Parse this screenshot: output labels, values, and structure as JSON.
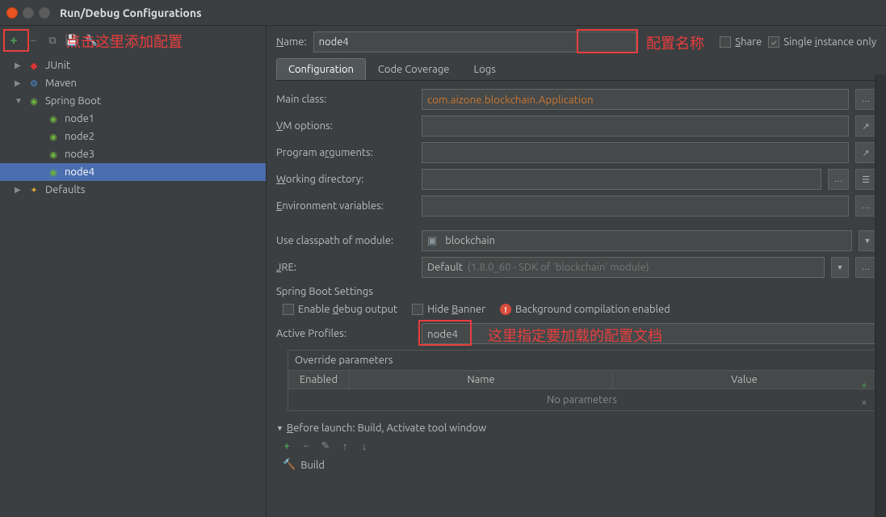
{
  "window": {
    "title": "Run/Debug Configurations"
  },
  "annotations": {
    "add_here": "点击这里添加配置",
    "config_name": "配置名称",
    "profile_hint": "这里指定要加载的配置文档"
  },
  "toolbar": {
    "add": "+",
    "remove": "−",
    "copy": "⧉",
    "save": "💾",
    "up": "↑",
    "down": "↓",
    "wrench": "🔧"
  },
  "tree": {
    "items": [
      {
        "label": "JUnit",
        "icon": "junit",
        "expand": "▶"
      },
      {
        "label": "Maven",
        "icon": "maven",
        "expand": "▶"
      },
      {
        "label": "Spring Boot",
        "icon": "spring",
        "expand": "▼",
        "children": [
          {
            "label": "node1"
          },
          {
            "label": "node2"
          },
          {
            "label": "node3"
          },
          {
            "label": "node4",
            "selected": true
          }
        ]
      },
      {
        "label": "Defaults",
        "icon": "defaults",
        "expand": "▶"
      }
    ]
  },
  "top": {
    "name_label": "Name:",
    "name_value": "node4",
    "share": "Share",
    "single": "Single instance only"
  },
  "tabs": [
    {
      "label": "Configuration",
      "active": true
    },
    {
      "label": "Code Coverage"
    },
    {
      "label": "Logs"
    }
  ],
  "form": {
    "main_class_label": "Main class:",
    "main_class_value": "com.aizone.blockchain.Application",
    "vm_label": "VM options:",
    "vm_value": "",
    "prog_args_label": "Program arguments:",
    "prog_args_value": "",
    "workdir_label": "Working directory:",
    "workdir_value": "",
    "env_label": "Environment variables:",
    "env_value": "",
    "classpath_label": "Use classpath of module:",
    "classpath_value": "blockchain",
    "jre_label": "JRE:",
    "jre_value": "Default",
    "jre_hint": "(1.8.0_60 - SDK of 'blockchain' module)"
  },
  "spring": {
    "title": "Spring Boot Settings",
    "debug": "Enable debug output",
    "hide_banner": "Hide Banner",
    "bg_compile": "Background compilation enabled",
    "profiles_label": "Active Profiles:",
    "profiles_value": "node4"
  },
  "override": {
    "title": "Override parameters",
    "col_enabled": "Enabled",
    "col_name": "Name",
    "col_value": "Value",
    "empty": "No parameters"
  },
  "before": {
    "title": "Before launch: Build, Activate tool window",
    "build": "Build"
  }
}
